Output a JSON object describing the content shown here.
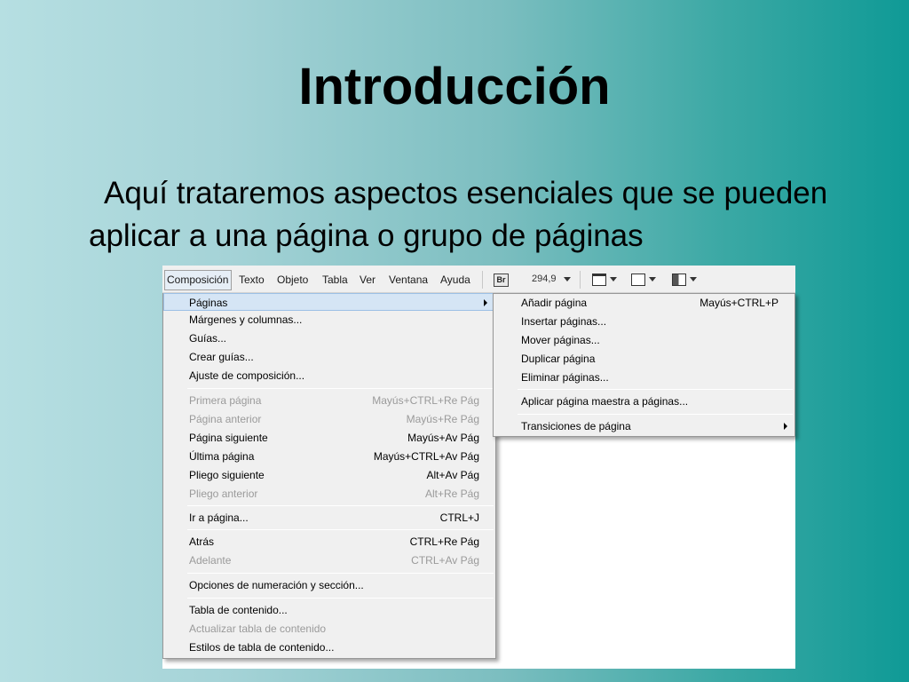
{
  "slide": {
    "title": "Introducción",
    "bullet": "Aquí trataremos aspectos esenciales que se pueden aplicar a una página o grupo de páginas"
  },
  "menubar": {
    "items": [
      "Composición",
      "Texto",
      "Objeto",
      "Tabla",
      "Ver",
      "Ventana",
      "Ayuda"
    ],
    "bridge_icon": "Br",
    "zoom_value": "294,9"
  },
  "menu_main": {
    "items": [
      {
        "label": "Páginas",
        "shortcut": "",
        "disabled": false,
        "submenu": true,
        "highlighted": true
      },
      {
        "label": "Márgenes y columnas...",
        "shortcut": ""
      },
      {
        "label": "Guías...",
        "shortcut": ""
      },
      {
        "label": "Crear guías...",
        "shortcut": ""
      },
      {
        "label": "Ajuste de composición...",
        "shortcut": ""
      },
      {
        "label": "Primera página",
        "shortcut": "Mayús+CTRL+Re Pág",
        "disabled": true
      },
      {
        "label": "Página anterior",
        "shortcut": "Mayús+Re Pág",
        "disabled": true
      },
      {
        "label": "Página siguiente",
        "shortcut": "Mayús+Av Pág"
      },
      {
        "label": "Última página",
        "shortcut": "Mayús+CTRL+Av Pág"
      },
      {
        "label": "Pliego siguiente",
        "shortcut": "Alt+Av Pág"
      },
      {
        "label": "Pliego anterior",
        "shortcut": "Alt+Re Pág",
        "disabled": true
      },
      {
        "label": "Ir a página...",
        "shortcut": "CTRL+J"
      },
      {
        "label": "Atrás",
        "shortcut": "CTRL+Re Pág"
      },
      {
        "label": "Adelante",
        "shortcut": "CTRL+Av Pág",
        "disabled": true
      },
      {
        "label": "Opciones de numeración y sección...",
        "shortcut": ""
      },
      {
        "label": "Tabla de contenido...",
        "shortcut": ""
      },
      {
        "label": "Actualizar tabla de contenido",
        "shortcut": "",
        "disabled": true
      },
      {
        "label": "Estilos de tabla de contenido...",
        "shortcut": ""
      }
    ]
  },
  "menu_sub": {
    "items": [
      {
        "label": "Añadir página",
        "shortcut": "Mayús+CTRL+P"
      },
      {
        "label": "Insertar páginas...",
        "shortcut": ""
      },
      {
        "label": "Mover páginas...",
        "shortcut": ""
      },
      {
        "label": "Duplicar página",
        "shortcut": ""
      },
      {
        "label": "Eliminar páginas...",
        "shortcut": ""
      },
      {
        "label": "Aplicar página maestra a páginas...",
        "shortcut": ""
      },
      {
        "label": "Transiciones de página",
        "shortcut": "",
        "submenu": true
      }
    ]
  },
  "colors": {
    "bg_left": "#b6dfe2",
    "bg_right": "#0f9a96",
    "menu_bg": "#f0f0f0",
    "highlight": "#d5e5f5",
    "disabled_text": "#9a9a9a"
  }
}
